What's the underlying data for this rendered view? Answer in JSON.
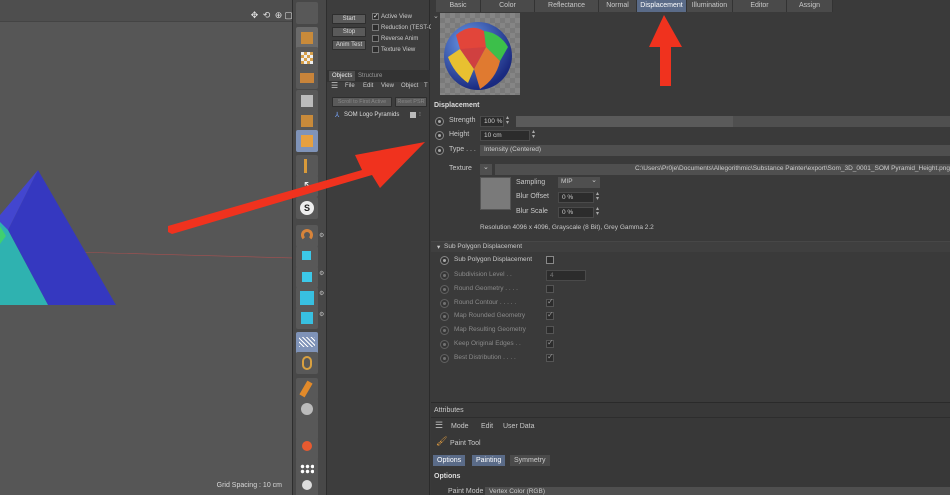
{
  "viewport": {
    "grid_spacing": "Grid Spacing : 10 cm",
    "icons": [
      "move-icon",
      "rotate-icon",
      "zoom-icon",
      "maximize-icon"
    ]
  },
  "object_manager": {
    "buttons": [
      "Start",
      "Stop",
      "Anim Test"
    ],
    "checkboxes": [
      {
        "label": "Active View",
        "checked": true
      },
      {
        "label": "Reduction (TEST-C",
        "checked": false
      },
      {
        "label": "Reverse Anim",
        "checked": false
      },
      {
        "label": "Texture View",
        "checked": false
      }
    ],
    "tabs": [
      "Objects",
      "Structure"
    ],
    "menu": [
      "File",
      "Edit",
      "View",
      "Object",
      "T"
    ],
    "scroll_buttons": [
      "Scroll to First Active",
      "Reset PSR"
    ],
    "object_name": "SOM Logo Pyramids"
  },
  "editor": {
    "tabs": [
      "Basic",
      "Color",
      "Reflectance",
      "Normal",
      "Displacement",
      "Illumination",
      "Editor",
      "Assign"
    ],
    "active_tab": "Displacement",
    "section_title": "Displacement",
    "strength": {
      "label": "Strength",
      "value": "100 %",
      "level": 0.5
    },
    "height": {
      "label": "Height",
      "value": "10 cm"
    },
    "type": {
      "label": "Type . . .",
      "value": "Intensity (Centered)"
    },
    "texture": {
      "label": "Texture",
      "path": "C:\\Users\\Pr0je\\Documents\\Allegorithmic\\Substance Painter\\export\\Som_3D_0001_SOM Pyramid_Height.png",
      "sampling_label": "Sampling",
      "sampling_value": "MIP",
      "blur_offset_label": "Blur Offset",
      "blur_offset_value": "0 %",
      "blur_scale_label": "Blur Scale",
      "blur_scale_value": "0 %",
      "resolution": "Resolution 4096 x 4096, Grayscale (8 Bit), Grey Gamma 2.2"
    },
    "sub_polygon": {
      "header": "Sub Polygon Displacement",
      "main_label": "Sub Polygon Displacement",
      "main_checked": false,
      "items": [
        {
          "label": "Subdivision Level . .",
          "value": "4"
        },
        {
          "label": "Round Geometry . . . .",
          "checked": false
        },
        {
          "label": "Round Contour . . . . .",
          "checked": true
        },
        {
          "label": "Map Rounded Geometry",
          "checked": true
        },
        {
          "label": "Map Resulting Geometry",
          "checked": false
        },
        {
          "label": "Keep Original Edges . .",
          "checked": true
        },
        {
          "label": "Best Distribution . . . .",
          "checked": true
        }
      ]
    }
  },
  "attributes": {
    "title": "Attributes",
    "menu": [
      "Mode",
      "Edit",
      "User Data"
    ],
    "tool_name": "Paint Tool",
    "tabs": [
      "Options",
      "Painting",
      "Symmetry"
    ],
    "section": "Options",
    "paint_mode_label": "Paint Mode",
    "paint_mode_value": "Vertex Color (RGB)"
  },
  "colors": {
    "arrow": "#f0321e",
    "accent": "#5a6b88",
    "pyramid_blue": "#3538c0",
    "pyramid_teal": "#2fb2b0"
  }
}
